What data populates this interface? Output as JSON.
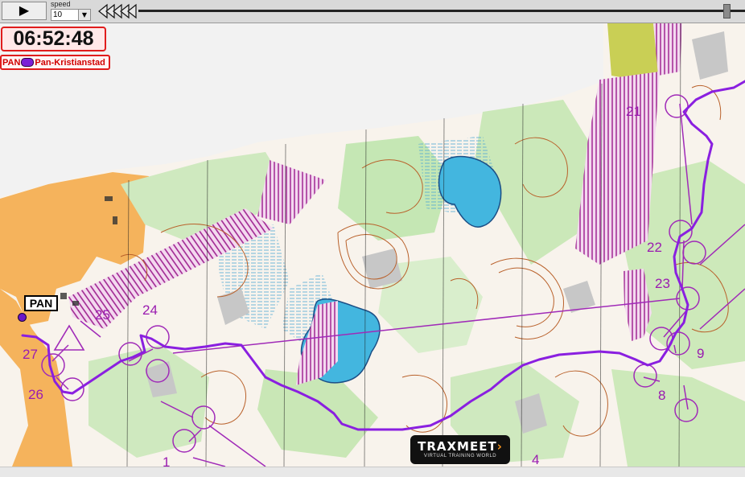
{
  "toolbar": {
    "play_icon": "play-icon",
    "play_glyph": "▶",
    "speed_label": "speed",
    "speed_value": "10",
    "rewind_icon": "rewind-icon",
    "timeline_progress": 0.97
  },
  "clock": {
    "time": "06:52:48"
  },
  "runner": {
    "club": "PAN",
    "name": "Pan-Kristianstad",
    "tag": "PAN",
    "color": "#7b1fd6"
  },
  "controls": [
    "21",
    "22",
    "23",
    "24",
    "25",
    "26",
    "27",
    "8",
    "9",
    "1",
    "4"
  ],
  "logo": {
    "name": "TRAXMEET",
    "tagline": "VIRTUAL TRAINING WORLD"
  },
  "colors": {
    "route": "#8a1fe0",
    "course": "#a02ab8",
    "water": "#43b6df",
    "forest": "#c5e7b4",
    "open_land": "#f5b35c",
    "contour": "#b9612b",
    "out_of_bounds": "#9b1a8c"
  }
}
